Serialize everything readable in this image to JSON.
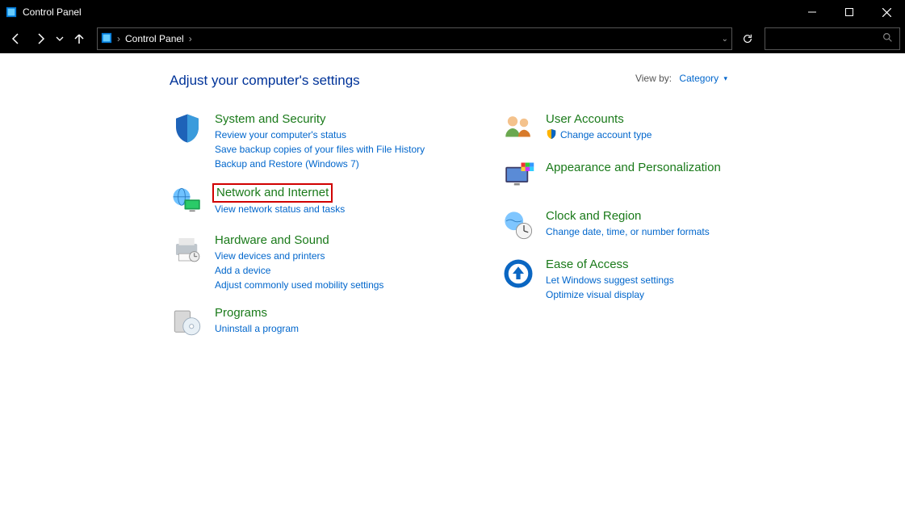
{
  "window": {
    "title": "Control Panel"
  },
  "breadcrumb": {
    "root": "Control Panel"
  },
  "header": {
    "heading": "Adjust your computer's settings",
    "viewby_label": "View by:",
    "viewby_value": "Category"
  },
  "left": [
    {
      "id": "system-security",
      "title": "System and Security",
      "links": [
        "Review your computer's status",
        "Save backup copies of your files with File History",
        "Backup and Restore (Windows 7)"
      ]
    },
    {
      "id": "network-internet",
      "title": "Network and Internet",
      "highlighted": true,
      "links": [
        "View network status and tasks"
      ]
    },
    {
      "id": "hardware-sound",
      "title": "Hardware and Sound",
      "links": [
        "View devices and printers",
        "Add a device",
        "Adjust commonly used mobility settings"
      ]
    },
    {
      "id": "programs",
      "title": "Programs",
      "links": [
        "Uninstall a program"
      ]
    }
  ],
  "right": [
    {
      "id": "user-accounts",
      "title": "User Accounts",
      "links": [
        {
          "text": "Change account type",
          "shield": true
        }
      ]
    },
    {
      "id": "appearance",
      "title": "Appearance and Personalization",
      "links": []
    },
    {
      "id": "clock-region",
      "title": "Clock and Region",
      "links": [
        "Change date, time, or number formats"
      ]
    },
    {
      "id": "ease-of-access",
      "title": "Ease of Access",
      "links": [
        "Let Windows suggest settings",
        "Optimize visual display"
      ]
    }
  ]
}
